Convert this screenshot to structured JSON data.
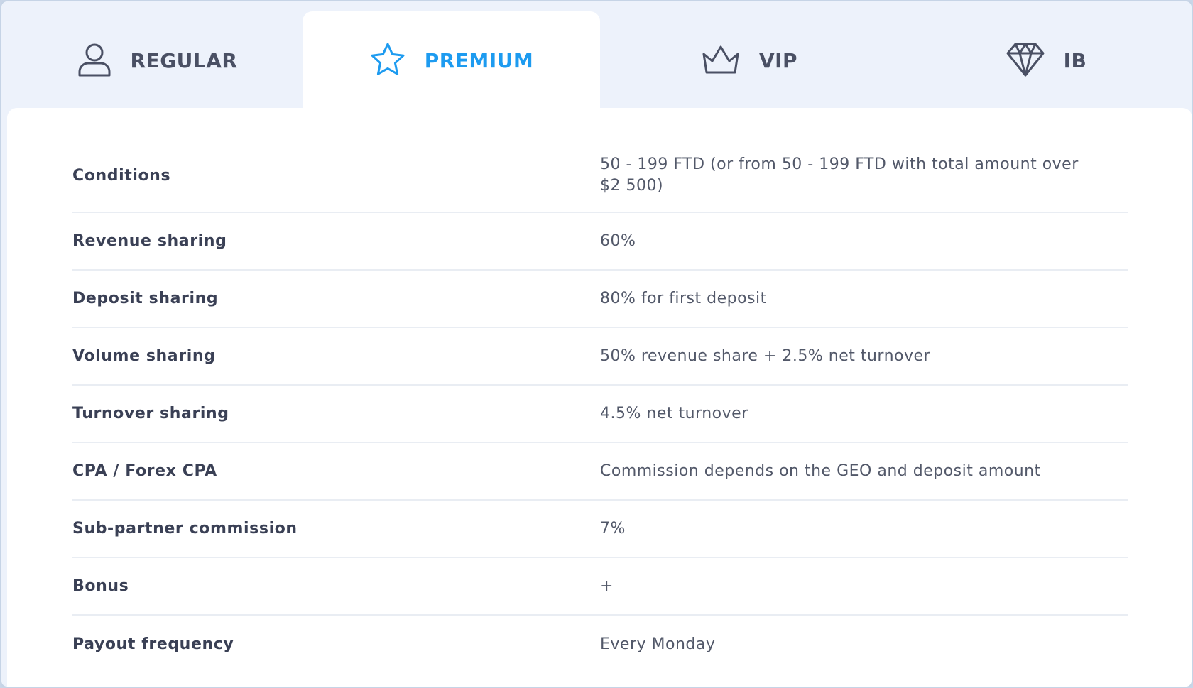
{
  "tabs": [
    {
      "label": "REGULAR",
      "icon": "user-icon",
      "active": false
    },
    {
      "label": "PREMIUM",
      "icon": "star-icon",
      "active": true
    },
    {
      "label": "VIP",
      "icon": "crown-icon",
      "active": false
    },
    {
      "label": "IB",
      "icon": "diamond-icon",
      "active": false
    }
  ],
  "colors": {
    "accent": "#1d9bf0",
    "text_dark": "#3a4055",
    "text_muted": "#525869",
    "background": "#edf2fb",
    "panel": "#ffffff",
    "divider": "#e9edf3"
  },
  "table": {
    "rows": [
      {
        "label": "Conditions",
        "value": "50 - 199 FTD (or from 50 - 199 FTD with total amount over $2 500)"
      },
      {
        "label": "Revenue sharing",
        "value": "60%"
      },
      {
        "label": "Deposit sharing",
        "value": "80% for first deposit"
      },
      {
        "label": "Volume sharing",
        "value": "50% revenue share + 2.5% net turnover"
      },
      {
        "label": "Turnover sharing",
        "value": "4.5% net turnover"
      },
      {
        "label": "CPA / Forex CPA",
        "value": "Commission depends on the GEO and deposit amount"
      },
      {
        "label": "Sub-partner commission",
        "value": "7%"
      },
      {
        "label": "Bonus",
        "value": "+"
      },
      {
        "label": "Payout frequency",
        "value": "Every Monday"
      }
    ]
  }
}
